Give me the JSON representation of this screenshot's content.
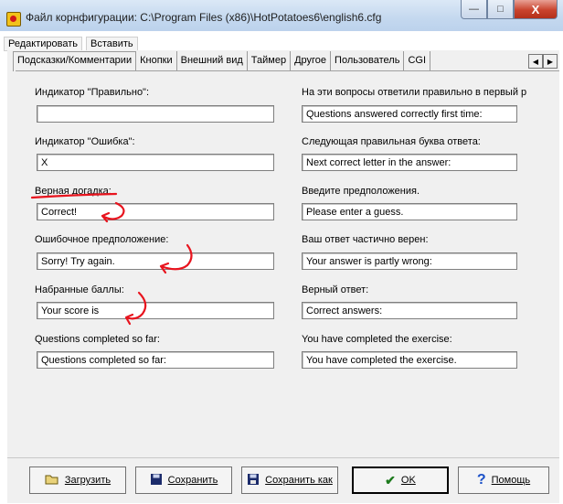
{
  "window": {
    "title": "Файл корнфигурации: C:\\Program Files (x86)\\HotPotatoes6\\english6.cfg",
    "minimize_label": "—",
    "maximize_label": "□",
    "close_label": "X"
  },
  "menu": {
    "items": [
      "Редактировать",
      "Вставить"
    ]
  },
  "tabs": [
    {
      "label": "Подсказки/Комментарии",
      "active": true
    },
    {
      "label": "Кнопки"
    },
    {
      "label": "Внешний вид"
    },
    {
      "label": "Таймер"
    },
    {
      "label": "Другое"
    },
    {
      "label": "Пользователь"
    },
    {
      "label": "CGI"
    }
  ],
  "tab_scroll": {
    "left": "◀",
    "right": "▶"
  },
  "left_fields": [
    {
      "label": "Индикатор \"Правильно\":",
      "value": ""
    },
    {
      "label": "Индикатор \"Ошибка\":",
      "value": "X"
    },
    {
      "label": "Верная догадка:",
      "value": "Correct!"
    },
    {
      "label": "Ошибочное предположение:",
      "value": "Sorry! Try again."
    },
    {
      "label": "Набранные баллы:",
      "value": "Your score is"
    },
    {
      "label": "Questions completed so far:",
      "value": "Questions completed so far:"
    }
  ],
  "right_fields": [
    {
      "label": "На эти вопросы ответили правильно в первый р",
      "value": "Questions answered correctly first time:"
    },
    {
      "label": "Следующая правильная буква ответа:",
      "value": "Next correct letter in the answer:"
    },
    {
      "label": "Введите предположения.",
      "value": "Please enter a guess."
    },
    {
      "label": "Ваш ответ частично верен:",
      "value": "Your answer is partly wrong:"
    },
    {
      "label": "Верный ответ:",
      "value": "Correct answers:"
    },
    {
      "label": "You have completed the exercise:",
      "value": "You have completed the exercise."
    }
  ],
  "buttons": {
    "load": "Загрузить",
    "save": "Сохранить",
    "save_as": "Сохранить как",
    "ok": "OK",
    "help": "Помощь"
  },
  "colors": {
    "annotation": "#e8141e",
    "ok_check": "#1d7a1d",
    "help_mark": "#1a50c8"
  }
}
